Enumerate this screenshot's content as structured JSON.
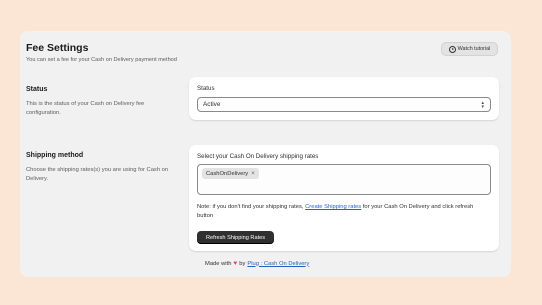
{
  "header": {
    "title": "Fee Settings",
    "subtitle": "You can set a fee for your Cash on Delivery payment method",
    "tutorial_label": "Watch tutorial"
  },
  "status_section": {
    "title": "Status",
    "description": "This is the status of your Cash on Delivery fee configuration.",
    "field_label": "Status",
    "selected_value": "Active"
  },
  "shipping_section": {
    "title": "Shipping method",
    "description": "Choose the shipping rates(s) you are using for Cash on Delivery.",
    "field_label": "Select your Cash On Delivery shipping rates",
    "tags": [
      "CashOnDelivery"
    ],
    "note_prefix": "Note: if you don't find your shipping rates,",
    "note_link": "Create Shipping rates",
    "note_suffix": "for your Cash On Delivery and click refresh button",
    "refresh_label": "Refresh Shipping Rates"
  },
  "footer": {
    "made_with": "Made with",
    "by": "by",
    "link": "Plug : Cash On Delivery"
  },
  "colors": {
    "background": "#fbe6d6",
    "panel": "#f1f1f1",
    "primary_button": "#303030",
    "link": "#2463bc",
    "heart": "#e0457b"
  }
}
